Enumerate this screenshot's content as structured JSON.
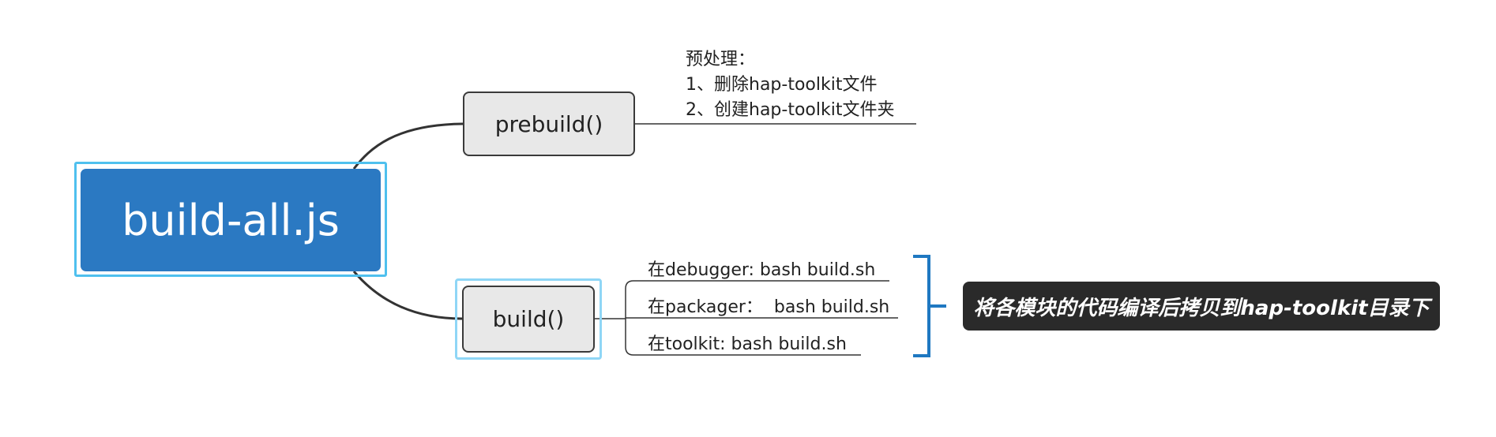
{
  "root": {
    "label": "build-all.js"
  },
  "branches": [
    {
      "label": "prebuild()",
      "note": [
        "预处理：",
        "1、删除hap-toolkit文件",
        "2、创建hap-toolkit文件夹"
      ]
    },
    {
      "label": "build()",
      "children": [
        "在debugger: bash build.sh",
        "在packager：  bash build.sh",
        "在toolkit: bash build.sh"
      ]
    }
  ],
  "summary": {
    "label": "将各模块的代码编译后拷贝到hap-toolkit目录下"
  },
  "colors": {
    "root_fill": "#2b79c2",
    "selection_outline": "#4fc0ee",
    "node_fill": "#e8e8e8",
    "connector": "#333333",
    "bracket": "#1f78c1",
    "summary_fill": "#2a2a2a"
  }
}
